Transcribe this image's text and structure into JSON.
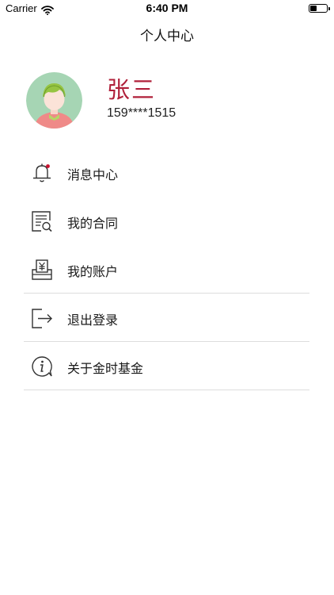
{
  "status_bar": {
    "carrier": "Carrier",
    "time": "6:40 PM",
    "battery_level": 0.4
  },
  "nav": {
    "title": "个人中心"
  },
  "profile": {
    "name": "张三",
    "phone": "159****1515"
  },
  "menu": {
    "items": [
      {
        "label": "消息中心",
        "icon": "bell-icon",
        "divider": false
      },
      {
        "label": "我的合同",
        "icon": "contract-icon",
        "divider": false
      },
      {
        "label": "我的账户",
        "icon": "account-icon",
        "divider": true
      },
      {
        "label": "退出登录",
        "icon": "logout-icon",
        "divider": true
      },
      {
        "label": "关于金时基金",
        "icon": "info-icon",
        "divider": true
      }
    ]
  },
  "colors": {
    "accent": "#b0203a",
    "icon_stroke": "#333333",
    "divider": "#dddddd",
    "notification_dot": "#c8102e"
  }
}
